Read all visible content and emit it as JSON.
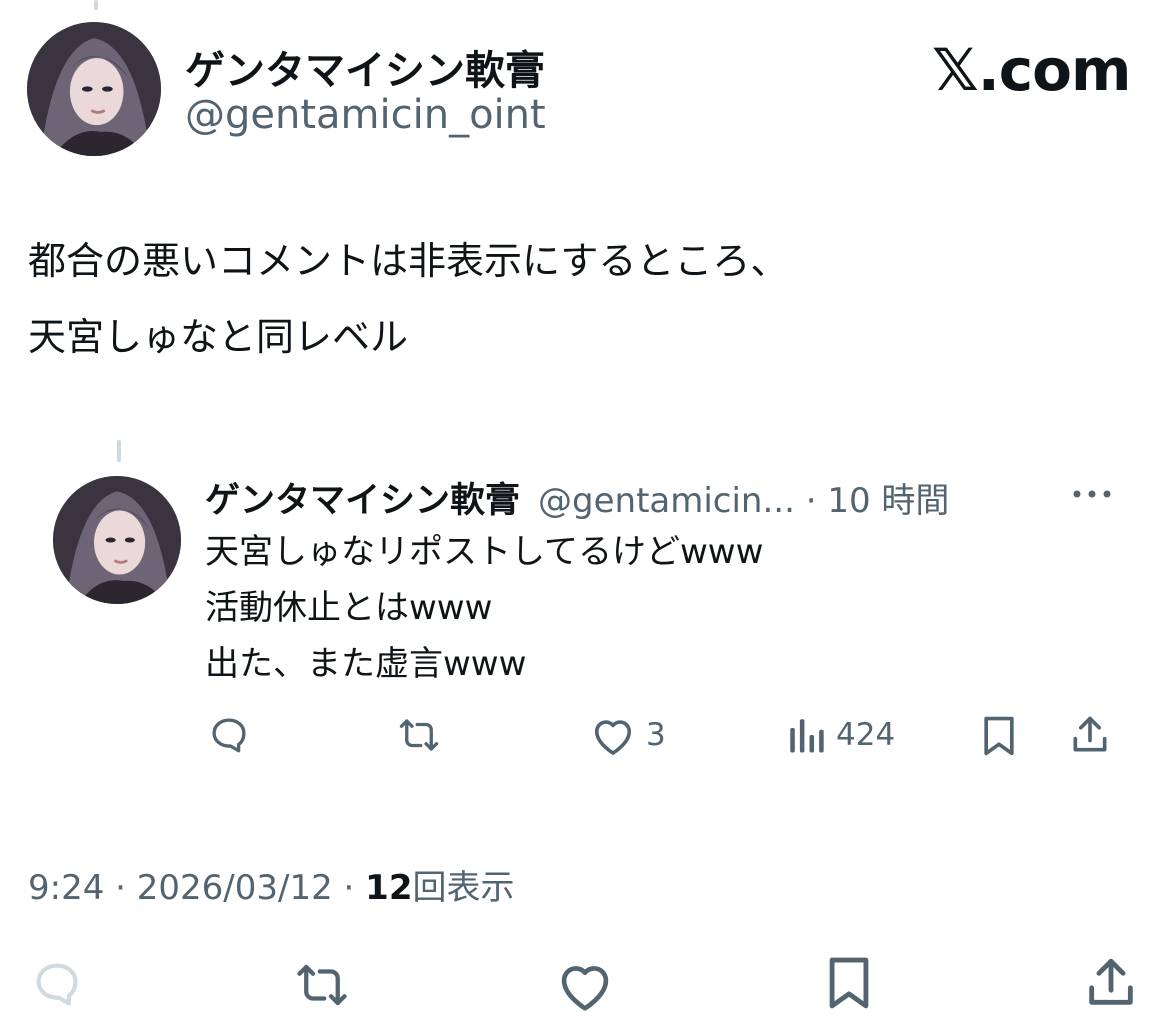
{
  "main_post": {
    "display_name": "ゲンタマイシン軟膏",
    "handle": "@gentamicin_oint",
    "site_logo": "𝕏.com",
    "text_lines": [
      "都合の悪いコメントは非表示にするところ、",
      "天宮しゅなと同レベル"
    ]
  },
  "quoted_post": {
    "display_name": "ゲンタマイシン軟膏",
    "handle_time": "@gentamicin... · 10 時間",
    "more_icon": "more-horizontal-icon",
    "text_lines": [
      "天宮しゅなリポストしてるけどwww",
      "活動休止とはwww",
      "出た、また虚言www"
    ],
    "actions": {
      "reply_icon": "reply-icon",
      "repost_icon": "repost-icon",
      "like_icon": "heart-icon",
      "like_count": "3",
      "views_icon": "analytics-icon",
      "views_count": "424",
      "bookmark_icon": "bookmark-icon",
      "share_icon": "share-icon"
    }
  },
  "meta": {
    "time_date": "9:24 · 2026/03/12 · ",
    "view_count": "12",
    "view_label": "回表示"
  },
  "bottom_actions": {
    "reply_icon": "reply-icon",
    "repost_icon": "repost-icon",
    "like_icon": "heart-icon",
    "bookmark_icon": "bookmark-icon",
    "share_icon": "share-icon"
  },
  "colors": {
    "text_primary": "#0f1419",
    "text_secondary": "#536471",
    "thread_line": "#cfd9de",
    "disabled_icon": "#cfd9de"
  }
}
